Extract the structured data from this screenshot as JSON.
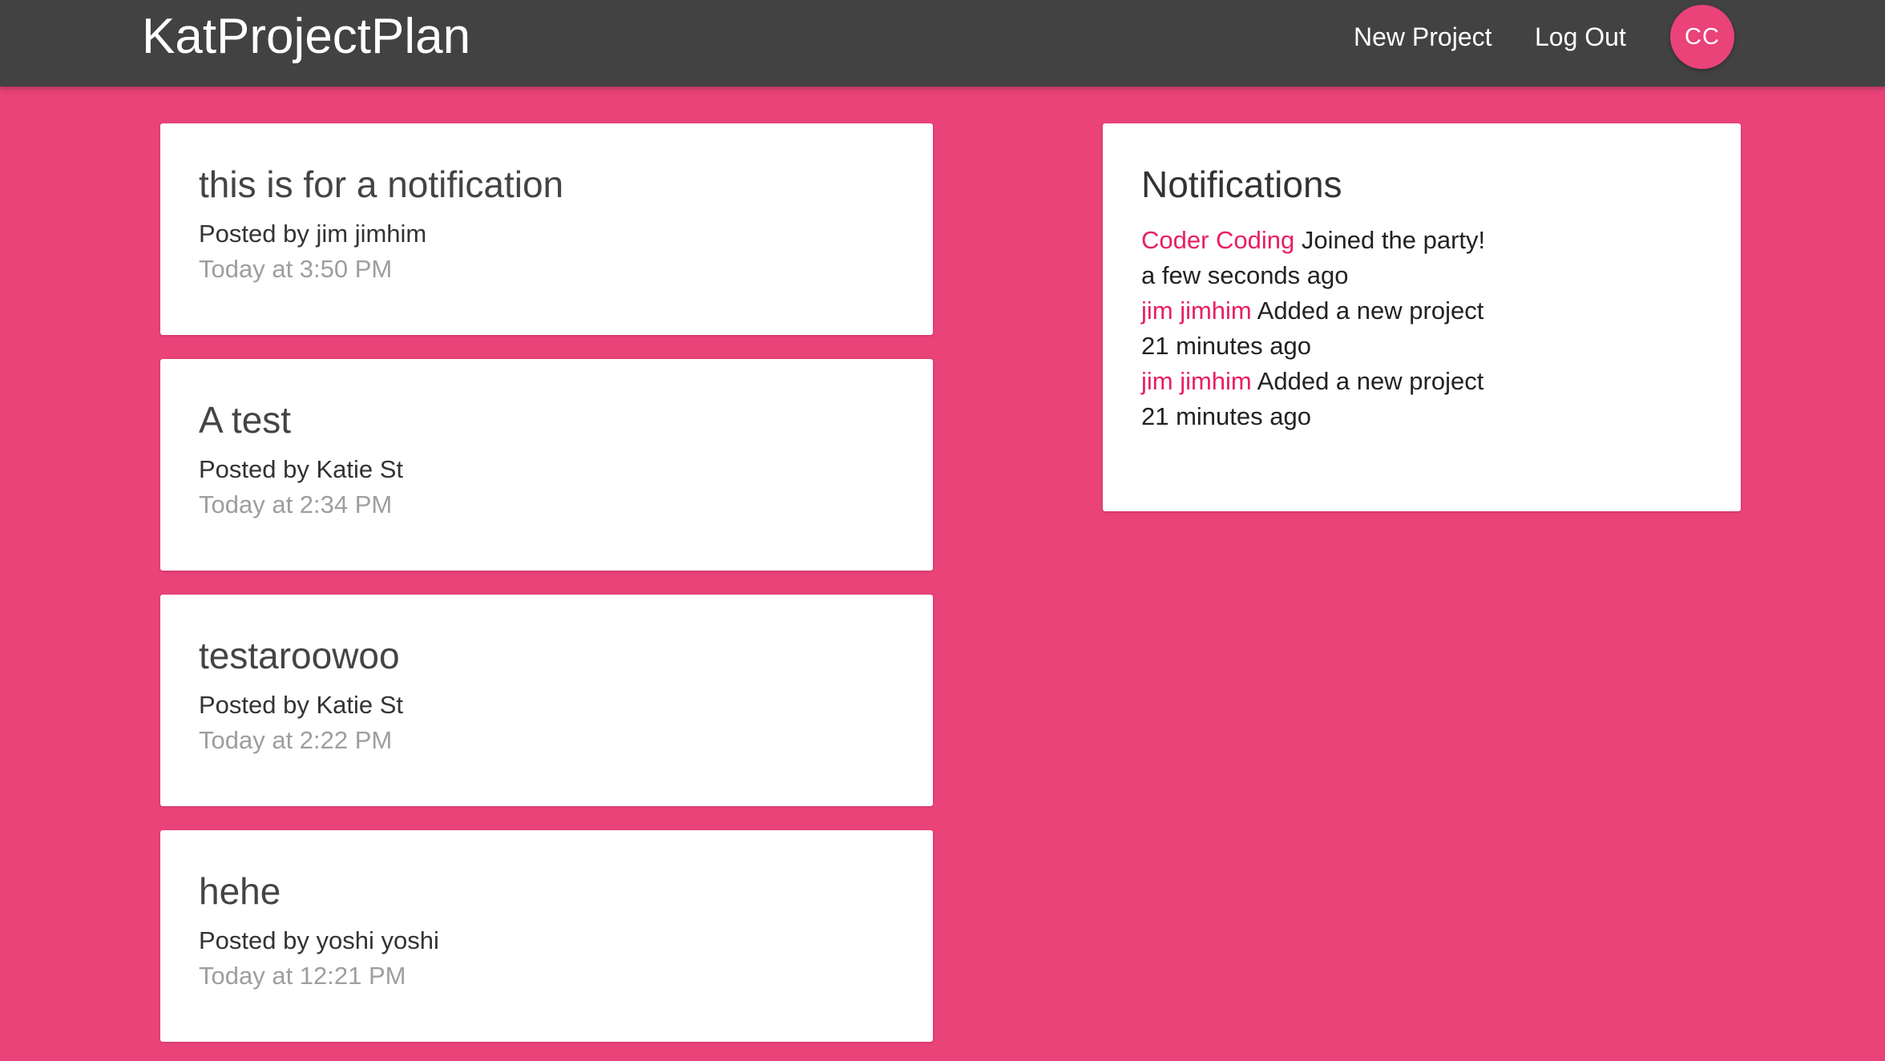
{
  "navbar": {
    "brand": "KatProjectPlan",
    "new_project": "New Project",
    "log_out": "Log Out",
    "avatar_initials": "CC"
  },
  "projects": [
    {
      "title": "this is for a notification",
      "author": "Posted by jim jimhim",
      "time": "Today at 3:50 PM"
    },
    {
      "title": "A test",
      "author": "Posted by Katie St",
      "time": "Today at 2:34 PM"
    },
    {
      "title": "testaroowoo",
      "author": "Posted by Katie St",
      "time": "Today at 2:22 PM"
    },
    {
      "title": "hehe",
      "author": "Posted by yoshi yoshi",
      "time": "Today at 12:21 PM"
    }
  ],
  "notifications": {
    "title": "Notifications",
    "items": [
      {
        "user": "Coder Coding",
        "content": "Joined the party!",
        "time": "a few seconds ago"
      },
      {
        "user": "jim jimhim",
        "content": "Added a new project",
        "time": "21 minutes ago"
      },
      {
        "user": "jim jimhim",
        "content": "Added a new project",
        "time": "21 minutes ago"
      }
    ]
  },
  "colors": {
    "background": "#e94379",
    "navbar": "#424242",
    "accent_text": "#e91e63",
    "card": "#ffffff"
  }
}
